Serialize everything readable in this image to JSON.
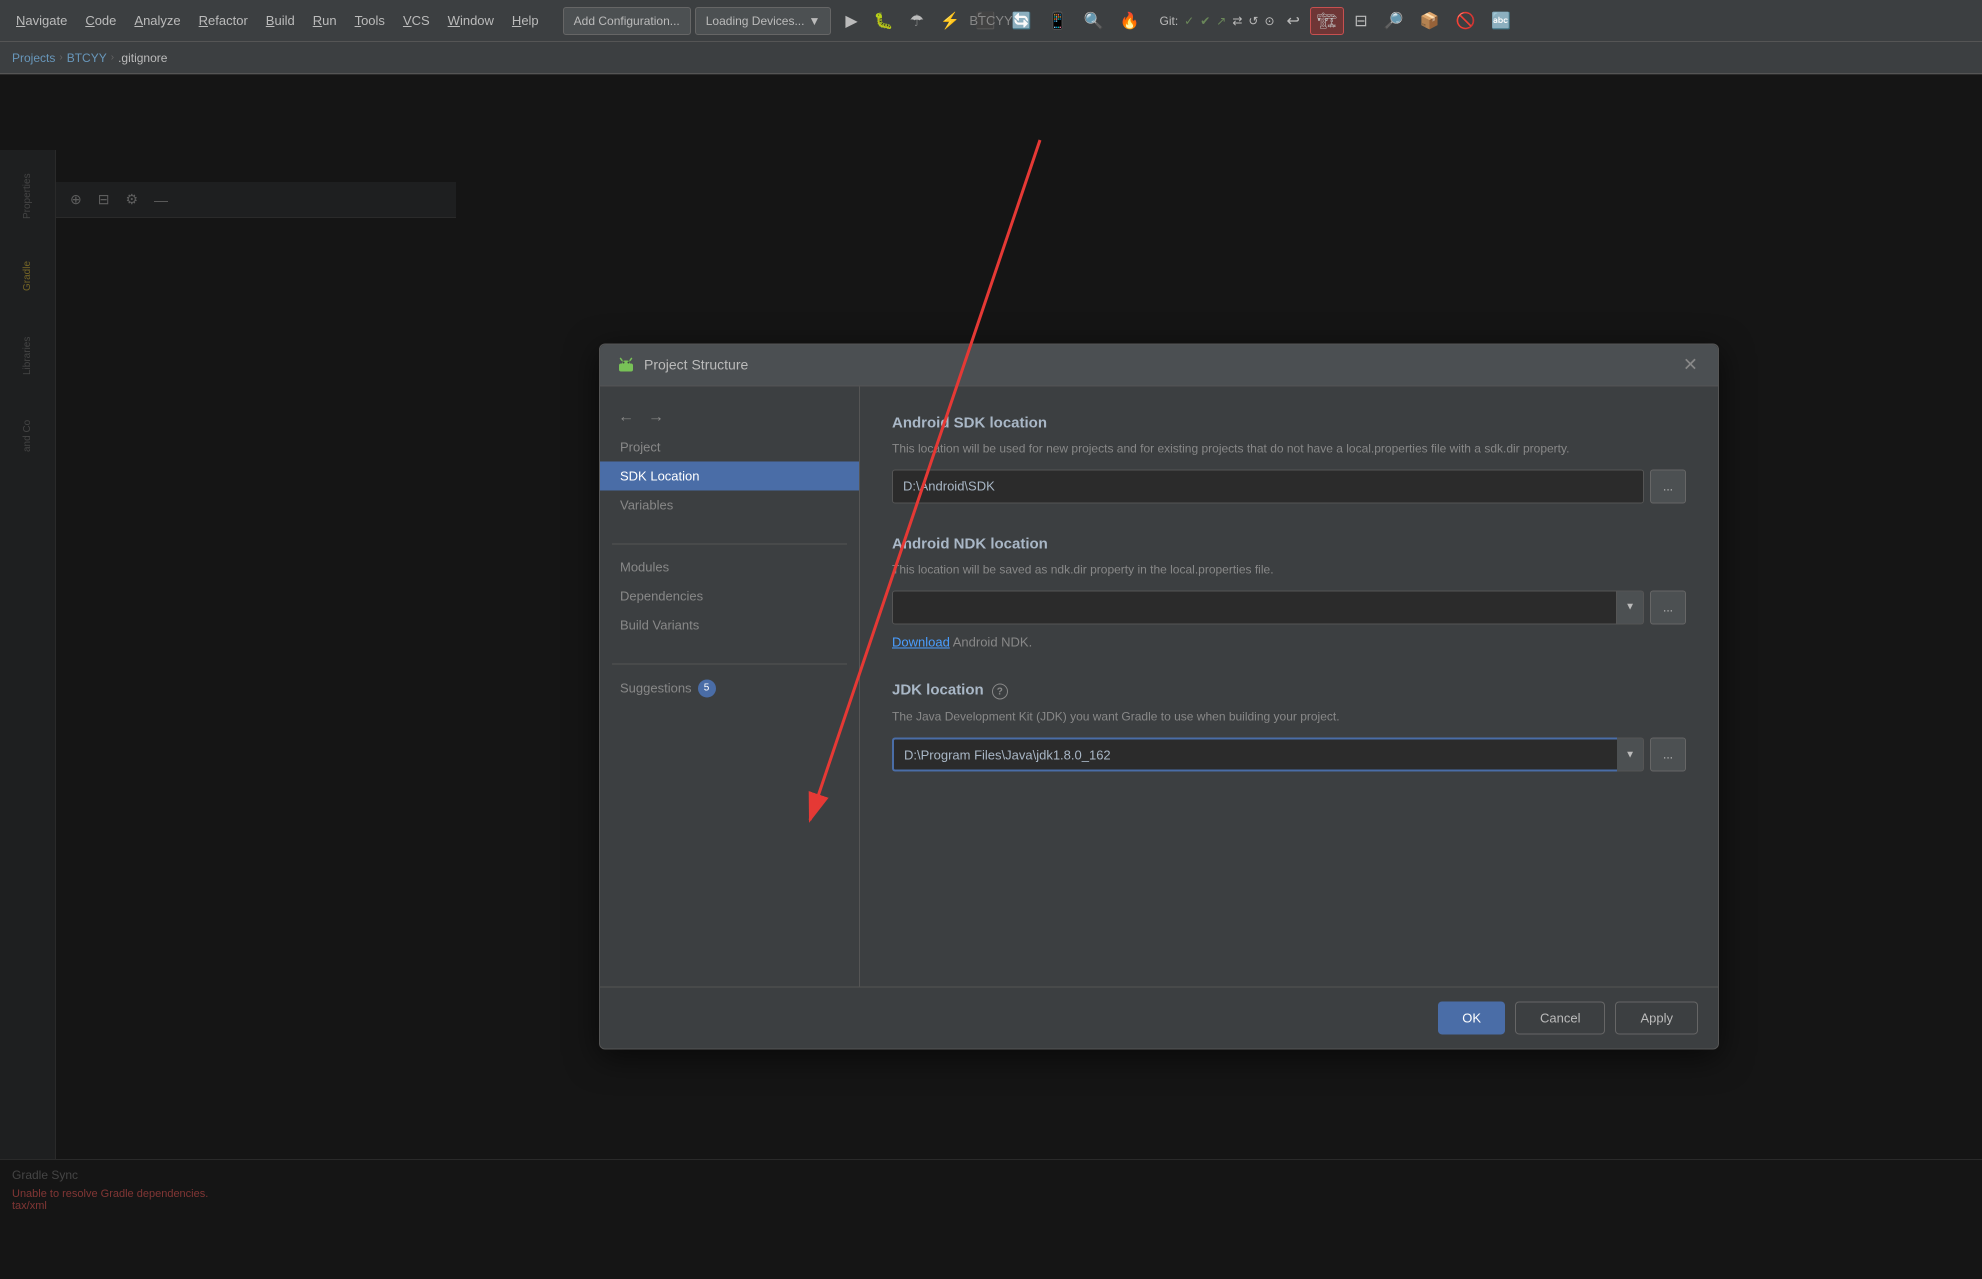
{
  "app": {
    "title": "BTCYY"
  },
  "menu": {
    "items": [
      {
        "label": "Navigate",
        "underline": "N"
      },
      {
        "label": "Code",
        "underline": "C"
      },
      {
        "label": "Analyze",
        "underline": "A"
      },
      {
        "label": "Refactor",
        "underline": "R"
      },
      {
        "label": "Build",
        "underline": "B"
      },
      {
        "label": "Run",
        "underline": "R"
      },
      {
        "label": "Tools",
        "underline": "T"
      },
      {
        "label": "VCS",
        "underline": "V"
      },
      {
        "label": "Window",
        "underline": "W"
      },
      {
        "label": "Help",
        "underline": "H"
      }
    ]
  },
  "toolbar": {
    "config_btn": "Add Configuration...",
    "loading_devices": "Loading Devices...",
    "git_label": "Git:"
  },
  "breadcrumb": {
    "items": [
      "Projects",
      "BTCYY",
      ".gitignore"
    ]
  },
  "dialog": {
    "title": "Project Structure",
    "nav": {
      "back_tooltip": "Back",
      "forward_tooltip": "Forward",
      "items": [
        {
          "label": "Project",
          "id": "project"
        },
        {
          "label": "SDK Location",
          "id": "sdk-location",
          "active": true
        },
        {
          "label": "Variables",
          "id": "variables"
        },
        {
          "label": "Modules",
          "id": "modules"
        },
        {
          "label": "Dependencies",
          "id": "dependencies"
        },
        {
          "label": "Build Variants",
          "id": "build-variants"
        }
      ],
      "suggestions": {
        "label": "Suggestions",
        "count": "5"
      }
    },
    "content": {
      "sdk_section": {
        "title": "Android SDK location",
        "description": "This location will be used for new projects and for existing projects that do not have a local.properties file with a sdk.dir property.",
        "value": "D:\\Android\\SDK",
        "browse_label": "..."
      },
      "ndk_section": {
        "title": "Android NDK location",
        "description": "This location will be saved as ndk.dir property in the local.properties file.",
        "value": "",
        "browse_label": "...",
        "download_text": "Download",
        "download_suffix": " Android NDK."
      },
      "jdk_section": {
        "title": "JDK location",
        "description": "The Java Development Kit (JDK) you want Gradle to use when building your project.",
        "help_icon": "?",
        "value": "D:\\Program Files\\Java\\jdk1.8.0_162",
        "browse_label": "..."
      }
    },
    "footer": {
      "ok_label": "OK",
      "cancel_label": "Cancel",
      "apply_label": "Apply"
    }
  },
  "sidebar_panels": [
    {
      "label": "Properties",
      "active": false
    },
    {
      "label": "Gradle",
      "active": false
    },
    {
      "label": "Libraries",
      "active": false
    },
    {
      "label": "and Co",
      "active": false
    }
  ],
  "bottom_panel": {
    "title": "Gradle Sync",
    "lines": [
      "Unable to resolve Gradle dependencies.",
      "tax/xml"
    ]
  }
}
